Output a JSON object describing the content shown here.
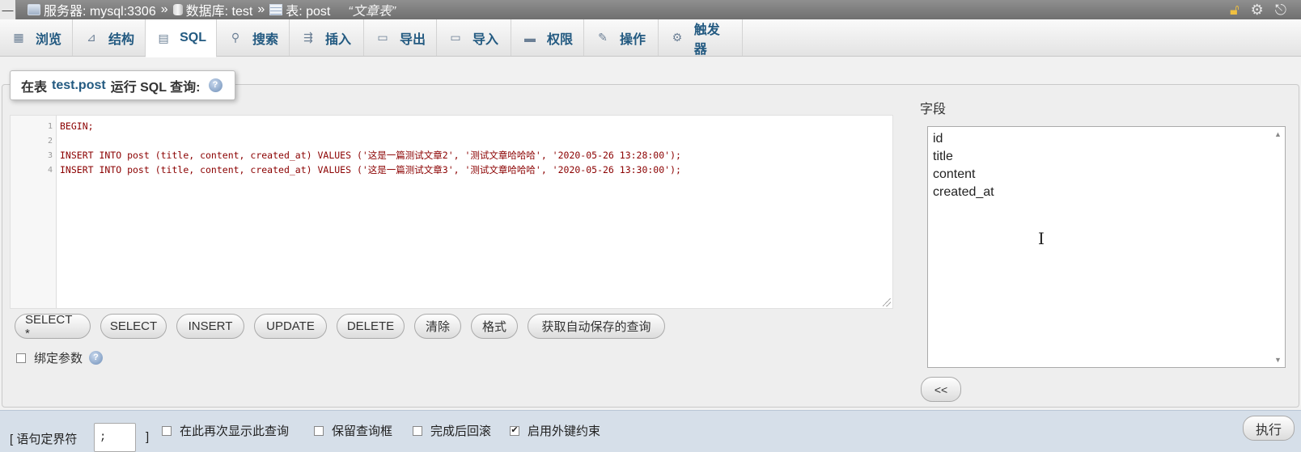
{
  "breadcrumb": {
    "collapse": "—",
    "server": "服务器: mysql:3306",
    "db": "数据库: test",
    "table": "表: post",
    "sep": "»",
    "comment": "“文章表”"
  },
  "tabs": [
    {
      "label": "浏览",
      "icon": "browse-icon",
      "glyph": "▦"
    },
    {
      "label": "结构",
      "icon": "structure-icon",
      "glyph": "⊿"
    },
    {
      "label": "SQL",
      "icon": "sql-icon",
      "glyph": "▤"
    },
    {
      "label": "搜索",
      "icon": "search-icon",
      "glyph": "⚲"
    },
    {
      "label": "插入",
      "icon": "insert-icon",
      "glyph": "⇶"
    },
    {
      "label": "导出",
      "icon": "export-icon",
      "glyph": "▭"
    },
    {
      "label": "导入",
      "icon": "import-icon",
      "glyph": "▭"
    },
    {
      "label": "权限",
      "icon": "privileges-icon",
      "glyph": "▬"
    },
    {
      "label": "操作",
      "icon": "operations-icon",
      "glyph": "✎"
    },
    {
      "label": "触发器",
      "icon": "triggers-icon",
      "glyph": "⚙"
    }
  ],
  "active_tab": "SQL",
  "query_box": {
    "prefix": "在表",
    "table": "test.post",
    "suffix": "运行 SQL 查询:",
    "help": "?"
  },
  "editor": {
    "lines": [
      {
        "n": "1",
        "code": "BEGIN;"
      },
      {
        "n": "2",
        "code": ""
      },
      {
        "n": "3",
        "code": "INSERT INTO post (title, content, created_at) VALUES ('这是一篇测试文章2', '测试文章哈哈哈', '2020-05-26 13:28:00');"
      },
      {
        "n": "4",
        "code": "INSERT INTO post (title, content, created_at) VALUES ('这是一篇测试文章3', '测试文章哈哈哈', '2020-05-26 13:30:00');"
      }
    ]
  },
  "snippet_buttons": [
    "SELECT *",
    "SELECT",
    "INSERT",
    "UPDATE",
    "DELETE",
    "清除",
    "格式",
    "获取自动保存的查询"
  ],
  "bind_params": {
    "label": "绑定参数",
    "checked": false
  },
  "fields": {
    "title": "字段",
    "items": [
      "id",
      "title",
      "content",
      "created_at"
    ],
    "insert_button": "<<"
  },
  "footer": {
    "delimiter_label": "[ 语句定界符",
    "delimiter_value": ";",
    "delimiter_close": "]",
    "options": [
      {
        "label": "在此再次显示此查询",
        "checked": false
      },
      {
        "label": "保留查询框",
        "checked": false
      },
      {
        "label": "完成后回滚",
        "checked": false
      },
      {
        "label": "启用外键约束",
        "checked": true
      }
    ],
    "go_button": "执行"
  }
}
